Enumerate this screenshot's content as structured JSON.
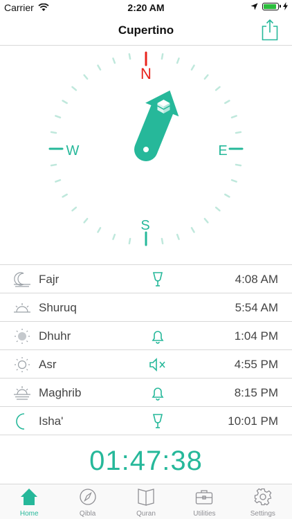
{
  "status_bar": {
    "carrier": "Carrier",
    "time": "2:20 AM"
  },
  "nav": {
    "title": "Cupertino"
  },
  "compass": {
    "directions": {
      "north": "N",
      "east": "E",
      "south": "S",
      "west": "W"
    },
    "colors": {
      "accent": "#26b89a",
      "north": "#e8231c",
      "tick_light": "#bfe8dc"
    }
  },
  "prayers": [
    {
      "name": "Fajr",
      "time": "4:08 AM",
      "icon": "fajr-sunrise-icon",
      "alert": "speaker-icon"
    },
    {
      "name": "Shuruq",
      "time": "5:54 AM",
      "icon": "sunrise-icon",
      "alert": ""
    },
    {
      "name": "Dhuhr",
      "time": "1:04 PM",
      "icon": "sun-full-icon",
      "alert": "bell-icon"
    },
    {
      "name": "Asr",
      "time": "4:55 PM",
      "icon": "sun-outline-icon",
      "alert": "mute-icon"
    },
    {
      "name": "Maghrib",
      "time": "8:15 PM",
      "icon": "sunset-icon",
      "alert": "bell-icon"
    },
    {
      "name": "Isha'",
      "time": "10:01 PM",
      "icon": "moon-icon",
      "alert": "speaker-icon"
    }
  ],
  "countdown": {
    "value": "01:47:38"
  },
  "tabs": [
    {
      "label": "Home",
      "icon": "home-icon",
      "active": true
    },
    {
      "label": "Qibla",
      "icon": "compass-icon",
      "active": false
    },
    {
      "label": "Quran",
      "icon": "book-icon",
      "active": false
    },
    {
      "label": "Utilities",
      "icon": "toolbox-icon",
      "active": false
    },
    {
      "label": "Settings",
      "icon": "gear-icon",
      "active": false
    }
  ]
}
